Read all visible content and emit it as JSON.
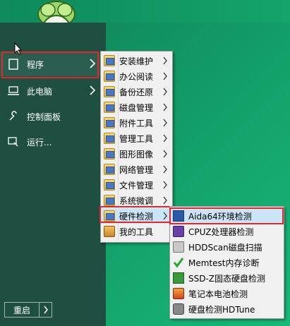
{
  "start_menu": {
    "items": [
      {
        "label": "程序",
        "icon": "document-icon",
        "has_arrow": true
      },
      {
        "label": "此电脑",
        "icon": "computer-icon",
        "has_arrow": true
      },
      {
        "label": "控制面板",
        "icon": "wrench-icon",
        "has_arrow": false
      },
      {
        "label": "运行...",
        "icon": "run-icon",
        "has_arrow": false
      }
    ],
    "restart_label": "重启"
  },
  "programs_submenu": {
    "items": [
      {
        "label": "安装维护",
        "has_arrow": true
      },
      {
        "label": "办公阅读",
        "has_arrow": true
      },
      {
        "label": "备份还原",
        "has_arrow": true
      },
      {
        "label": "磁盘管理",
        "has_arrow": true
      },
      {
        "label": "附件工具",
        "has_arrow": true
      },
      {
        "label": "管理工具",
        "has_arrow": true
      },
      {
        "label": "图形图像",
        "has_arrow": true
      },
      {
        "label": "网络管理",
        "has_arrow": true
      },
      {
        "label": "文件管理",
        "has_arrow": true
      },
      {
        "label": "系统微调",
        "has_arrow": true
      },
      {
        "label": "硬件检测",
        "has_arrow": true
      },
      {
        "label": "我的工具",
        "has_arrow": false
      }
    ]
  },
  "hardware_submenu": {
    "items": [
      {
        "label": "Aida64环境检测",
        "icon": "aida64-icon"
      },
      {
        "label": "CPUZ处理器检测",
        "icon": "cpuz-icon"
      },
      {
        "label": "HDDScan磁盘扫描",
        "icon": "hddscan-icon"
      },
      {
        "label": "Memtest内存诊断",
        "icon": "memtest-check-icon"
      },
      {
        "label": "SSD-Z固态硬盘检测",
        "icon": "ssdz-icon"
      },
      {
        "label": "笔记本电池检测",
        "icon": "battery-icon"
      },
      {
        "label": "硬盘检测HDTune",
        "icon": "hdtune-icon"
      }
    ]
  },
  "colors": {
    "accent_red": "#e02a2a",
    "menu_bg": "#1f4f40",
    "submenu_highlight": "#cce4f7"
  }
}
